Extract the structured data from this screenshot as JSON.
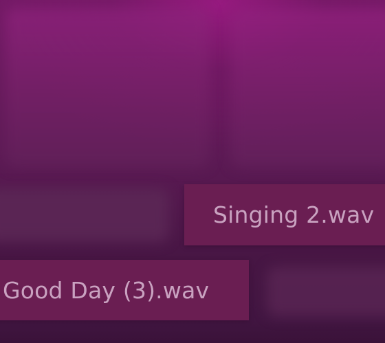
{
  "files": [
    {
      "name": "Singing 2.wav"
    },
    {
      "name": "Good Day (3).wav"
    }
  ],
  "theme": {
    "background_top": "#98208a",
    "background_bottom": "#3f1540",
    "chip_background": "#6a1e52",
    "chip_text": "#c9a2c0"
  }
}
